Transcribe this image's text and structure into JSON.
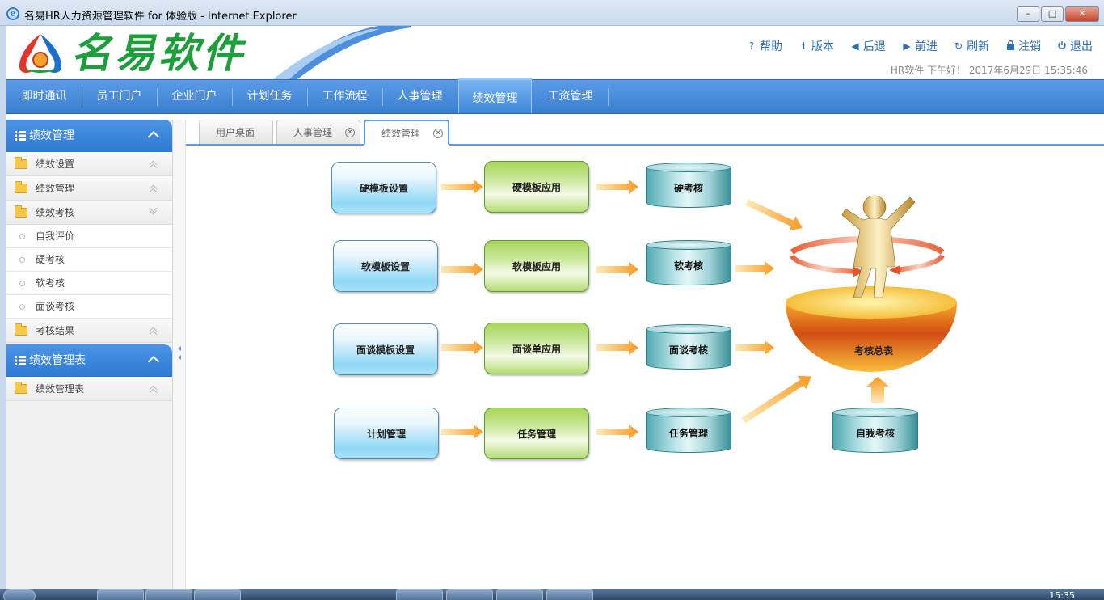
{
  "window": {
    "title": "名易HR人力资源管理软件 for 体验版 - Internet Explorer",
    "controls": [
      "–",
      "□",
      "✕"
    ]
  },
  "header": {
    "logo_text": "名易软件",
    "nav": [
      {
        "label": "帮助",
        "icon": "help-icon",
        "glyph": "?"
      },
      {
        "label": "版本",
        "icon": "info-icon",
        "glyph": "ℹ"
      },
      {
        "label": "后退",
        "icon": "back-icon",
        "glyph": "◀"
      },
      {
        "label": "前进",
        "icon": "forward-icon",
        "glyph": "▶"
      },
      {
        "label": "刷新",
        "icon": "refresh-icon",
        "glyph": "↻"
      },
      {
        "label": "注销",
        "icon": "lock-icon",
        "glyph": "🔒"
      },
      {
        "label": "退出",
        "icon": "power-icon",
        "glyph": "⏻"
      }
    ],
    "greeting": "HR软件 下午好！ 2017年6月29日 15:35:46"
  },
  "mainmenu": {
    "items": [
      "即时通讯",
      "员工门户",
      "企业门户",
      "计划任务",
      "工作流程",
      "人事管理",
      "绩效管理",
      "工资管理"
    ],
    "active": "绩效管理"
  },
  "sidebar": {
    "section1": {
      "title": "绩效管理",
      "folders": [
        {
          "label": "绩效设置",
          "expanded": false
        },
        {
          "label": "绩效管理",
          "expanded": false
        },
        {
          "label": "绩效考核",
          "expanded": true
        }
      ],
      "items": [
        "自我评价",
        "硬考核",
        "软考核",
        "面谈考核"
      ],
      "folder_after": {
        "label": "考核结果",
        "expanded": false
      }
    },
    "section2": {
      "title": "绩效管理表",
      "folders": [
        {
          "label": "绩效管理表",
          "expanded": false
        }
      ]
    }
  },
  "tabs": [
    {
      "label": "用户桌面",
      "closable": false
    },
    {
      "label": "人事管理",
      "closable": true
    },
    {
      "label": "绩效管理",
      "closable": true,
      "active": true
    }
  ],
  "flow": {
    "row1": {
      "template": "硬模板设置",
      "apply": "硬模板应用",
      "result": "硬考核"
    },
    "row2": {
      "template": "软模板设置",
      "apply": "软模板应用",
      "result": "软考核"
    },
    "row3": {
      "template": "面谈模板设置",
      "apply": "面谈单应用",
      "result": "面谈考核"
    },
    "row4": {
      "template": "计划管理",
      "apply": "任务管理",
      "result": "任务管理"
    },
    "self_review": "自我考核",
    "summary": "考核总表"
  },
  "taskbar": {
    "clock": "15:35"
  },
  "colors": {
    "menu_blue": "#3a7fd1",
    "logo_green": "#1c9e3a",
    "arrow_orange": "#f7a234"
  }
}
